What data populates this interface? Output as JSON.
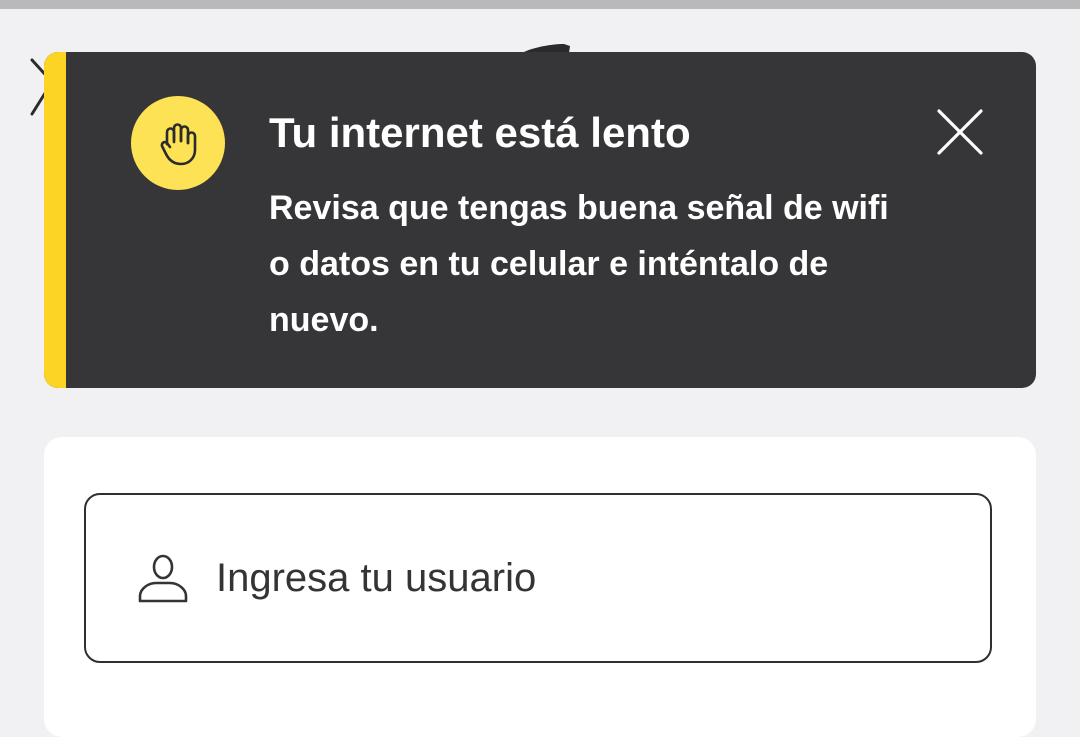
{
  "toast": {
    "title": "Tu internet está lento",
    "message": "Revisa que tengas buena señal de wifi o datos en tu celular e inténtalo de nuevo.",
    "icon": "hand-stop-icon",
    "close_icon": "close-icon",
    "accent_color": "#fcd424",
    "background_color": "#363638"
  },
  "login": {
    "username_placeholder": "Ingresa tu usuario",
    "username_icon": "user-icon"
  }
}
